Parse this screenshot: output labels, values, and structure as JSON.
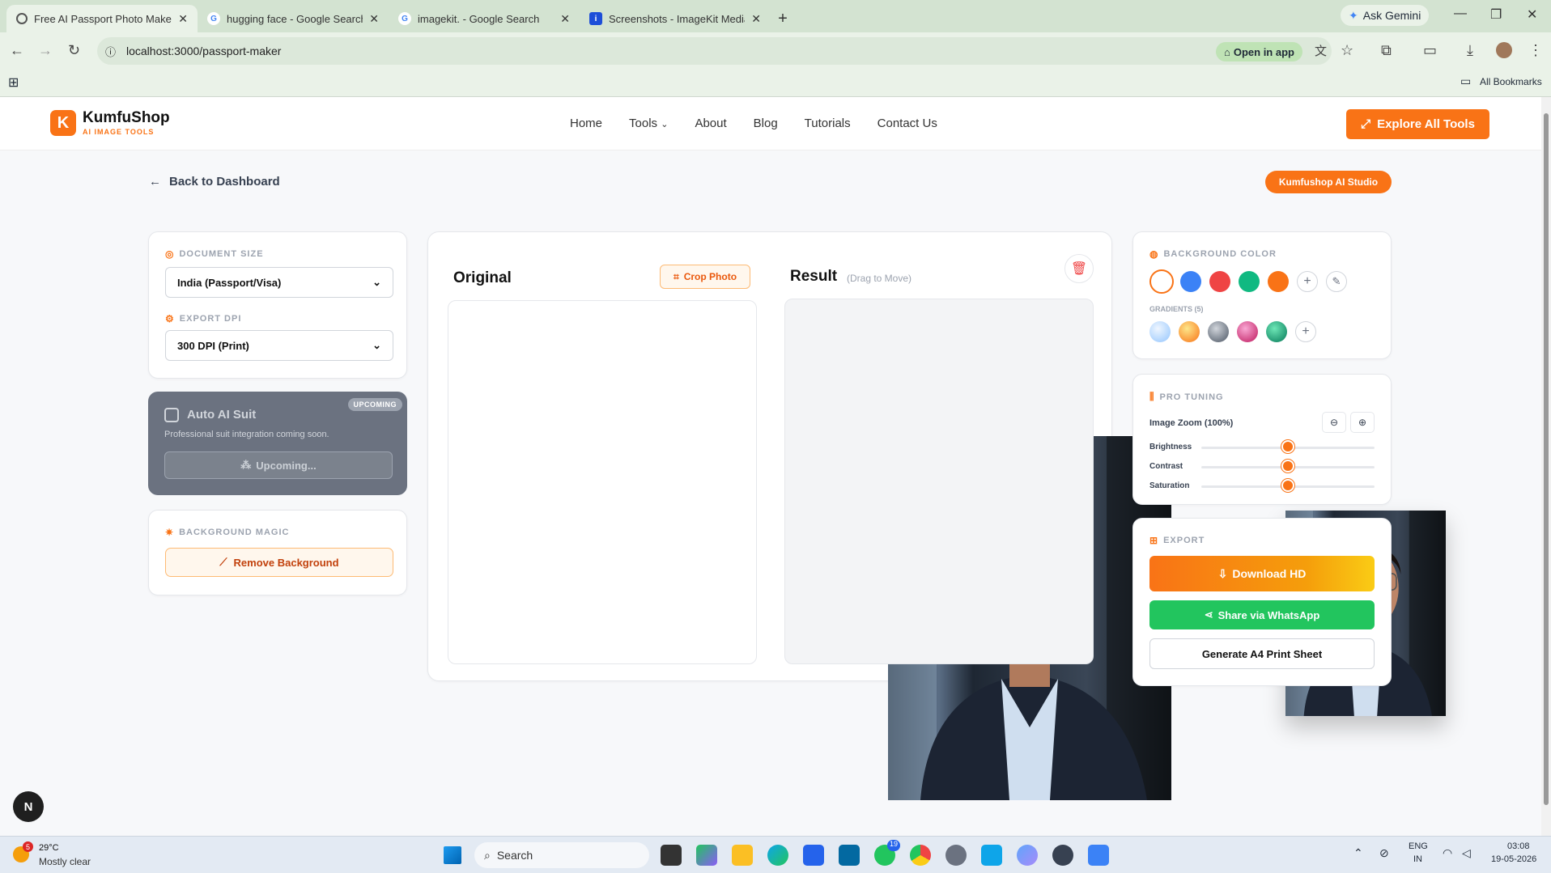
{
  "browser": {
    "tabs": [
      {
        "title": "Free AI Passport Photo Maker &",
        "active": true
      },
      {
        "title": "hugging face - Google Search",
        "active": false
      },
      {
        "title": "imagekit. - Google Search",
        "active": false
      },
      {
        "title": "Screenshots - ImageKit Media L",
        "active": false
      }
    ],
    "new_tab": "+",
    "ask_gemini": "Ask Gemini",
    "url": "localhost:3000/passport-maker",
    "open_in_app": "Open in app",
    "all_bookmarks": "All Bookmarks"
  },
  "site": {
    "logo_letter": "K",
    "brand": "KumfuShop",
    "tagline": "AI IMAGE TOOLS",
    "nav": [
      "Home",
      "Tools",
      "About",
      "Blog",
      "Tutorials",
      "Contact Us"
    ],
    "explore_button": "Explore All Tools",
    "back_link": "Back to Dashboard",
    "studio_badge": "Kumfushop AI Studio"
  },
  "left_panel": {
    "document_size_label": "DOCUMENT SIZE",
    "document_size_value": "India (Passport/Visa)",
    "export_dpi_label": "EXPORT DPI",
    "export_dpi_value": "300 DPI (Print)",
    "suit_title": "Auto AI Suit",
    "suit_badge": "UPCOMING",
    "suit_desc": "Professional suit integration coming soon.",
    "suit_button": "Upcoming...",
    "bg_magic_label": "BACKGROUND MAGIC",
    "remove_bg_button": "Remove Background"
  },
  "editor": {
    "original_title": "Original",
    "crop_button": "Crop Photo",
    "result_title": "Result",
    "result_hint": "(Drag to Move)"
  },
  "right_panel": {
    "bg_color_label": "BACKGROUND COLOR",
    "solid_colors": [
      "#ffffff",
      "#3b82f6",
      "#ef4444",
      "#10b981",
      "#f97316"
    ],
    "gradients_label": "GRADIENTS (5)",
    "gradient_colors": [
      "#bfdbfe",
      "#f59e0b",
      "#6b7280",
      "#db2777",
      "#059669"
    ],
    "pro_tuning_label": "PRO TUNING",
    "zoom_label": "Image Zoom (100%)",
    "sliders": [
      {
        "label": "Brightness",
        "value": 0.5
      },
      {
        "label": "Contrast",
        "value": 0.5
      },
      {
        "label": "Saturation",
        "value": 0.5
      }
    ],
    "export_label": "EXPORT",
    "download_button": "Download HD",
    "whatsapp_button": "Share via WhatsApp",
    "a4_button": "Generate A4 Print Sheet"
  },
  "taskbar": {
    "weather_temp": "29°C",
    "weather_desc": "Mostly clear",
    "weather_badge": "5",
    "search_placeholder": "Search",
    "whatsapp_badge": "19",
    "lang_top": "ENG",
    "lang_bottom": "IN",
    "time": "03:08",
    "date": "19-05-2026"
  },
  "next_badge": "N"
}
